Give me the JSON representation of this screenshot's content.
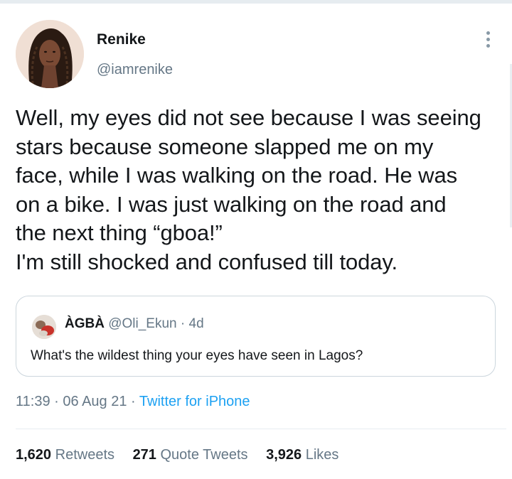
{
  "tweet": {
    "author": {
      "display_name": "Renike",
      "handle": "@iamrenike"
    },
    "text": "Well, my eyes did not see because I was seeing\nstars because someone slapped me on my\nface, while I was walking on the road. He was\non a bike. I was just walking on the road and\nthe next thing “gboa!”\nI'm still shocked and confused till today.",
    "quoted": {
      "display_name": "ÀGBÀ",
      "handle": "@Oli_Ekun",
      "separator": "·",
      "age": "4d",
      "text": "What's the wildest thing your eyes have seen in Lagos?"
    },
    "time": "11:39",
    "date": "06 Aug 21",
    "separator": "·",
    "source": "Twitter for iPhone",
    "stats": {
      "retweets_count": "1,620",
      "retweets_label": "Retweets",
      "quotes_count": "271",
      "quotes_label": "Quote Tweets",
      "likes_count": "3,926",
      "likes_label": "Likes"
    }
  },
  "colors": {
    "text_primary": "#14171a",
    "text_secondary": "#657786",
    "link": "#1da1f2",
    "border": "#ccd6dd"
  },
  "icons": {
    "more": "more-vertical-icon"
  }
}
